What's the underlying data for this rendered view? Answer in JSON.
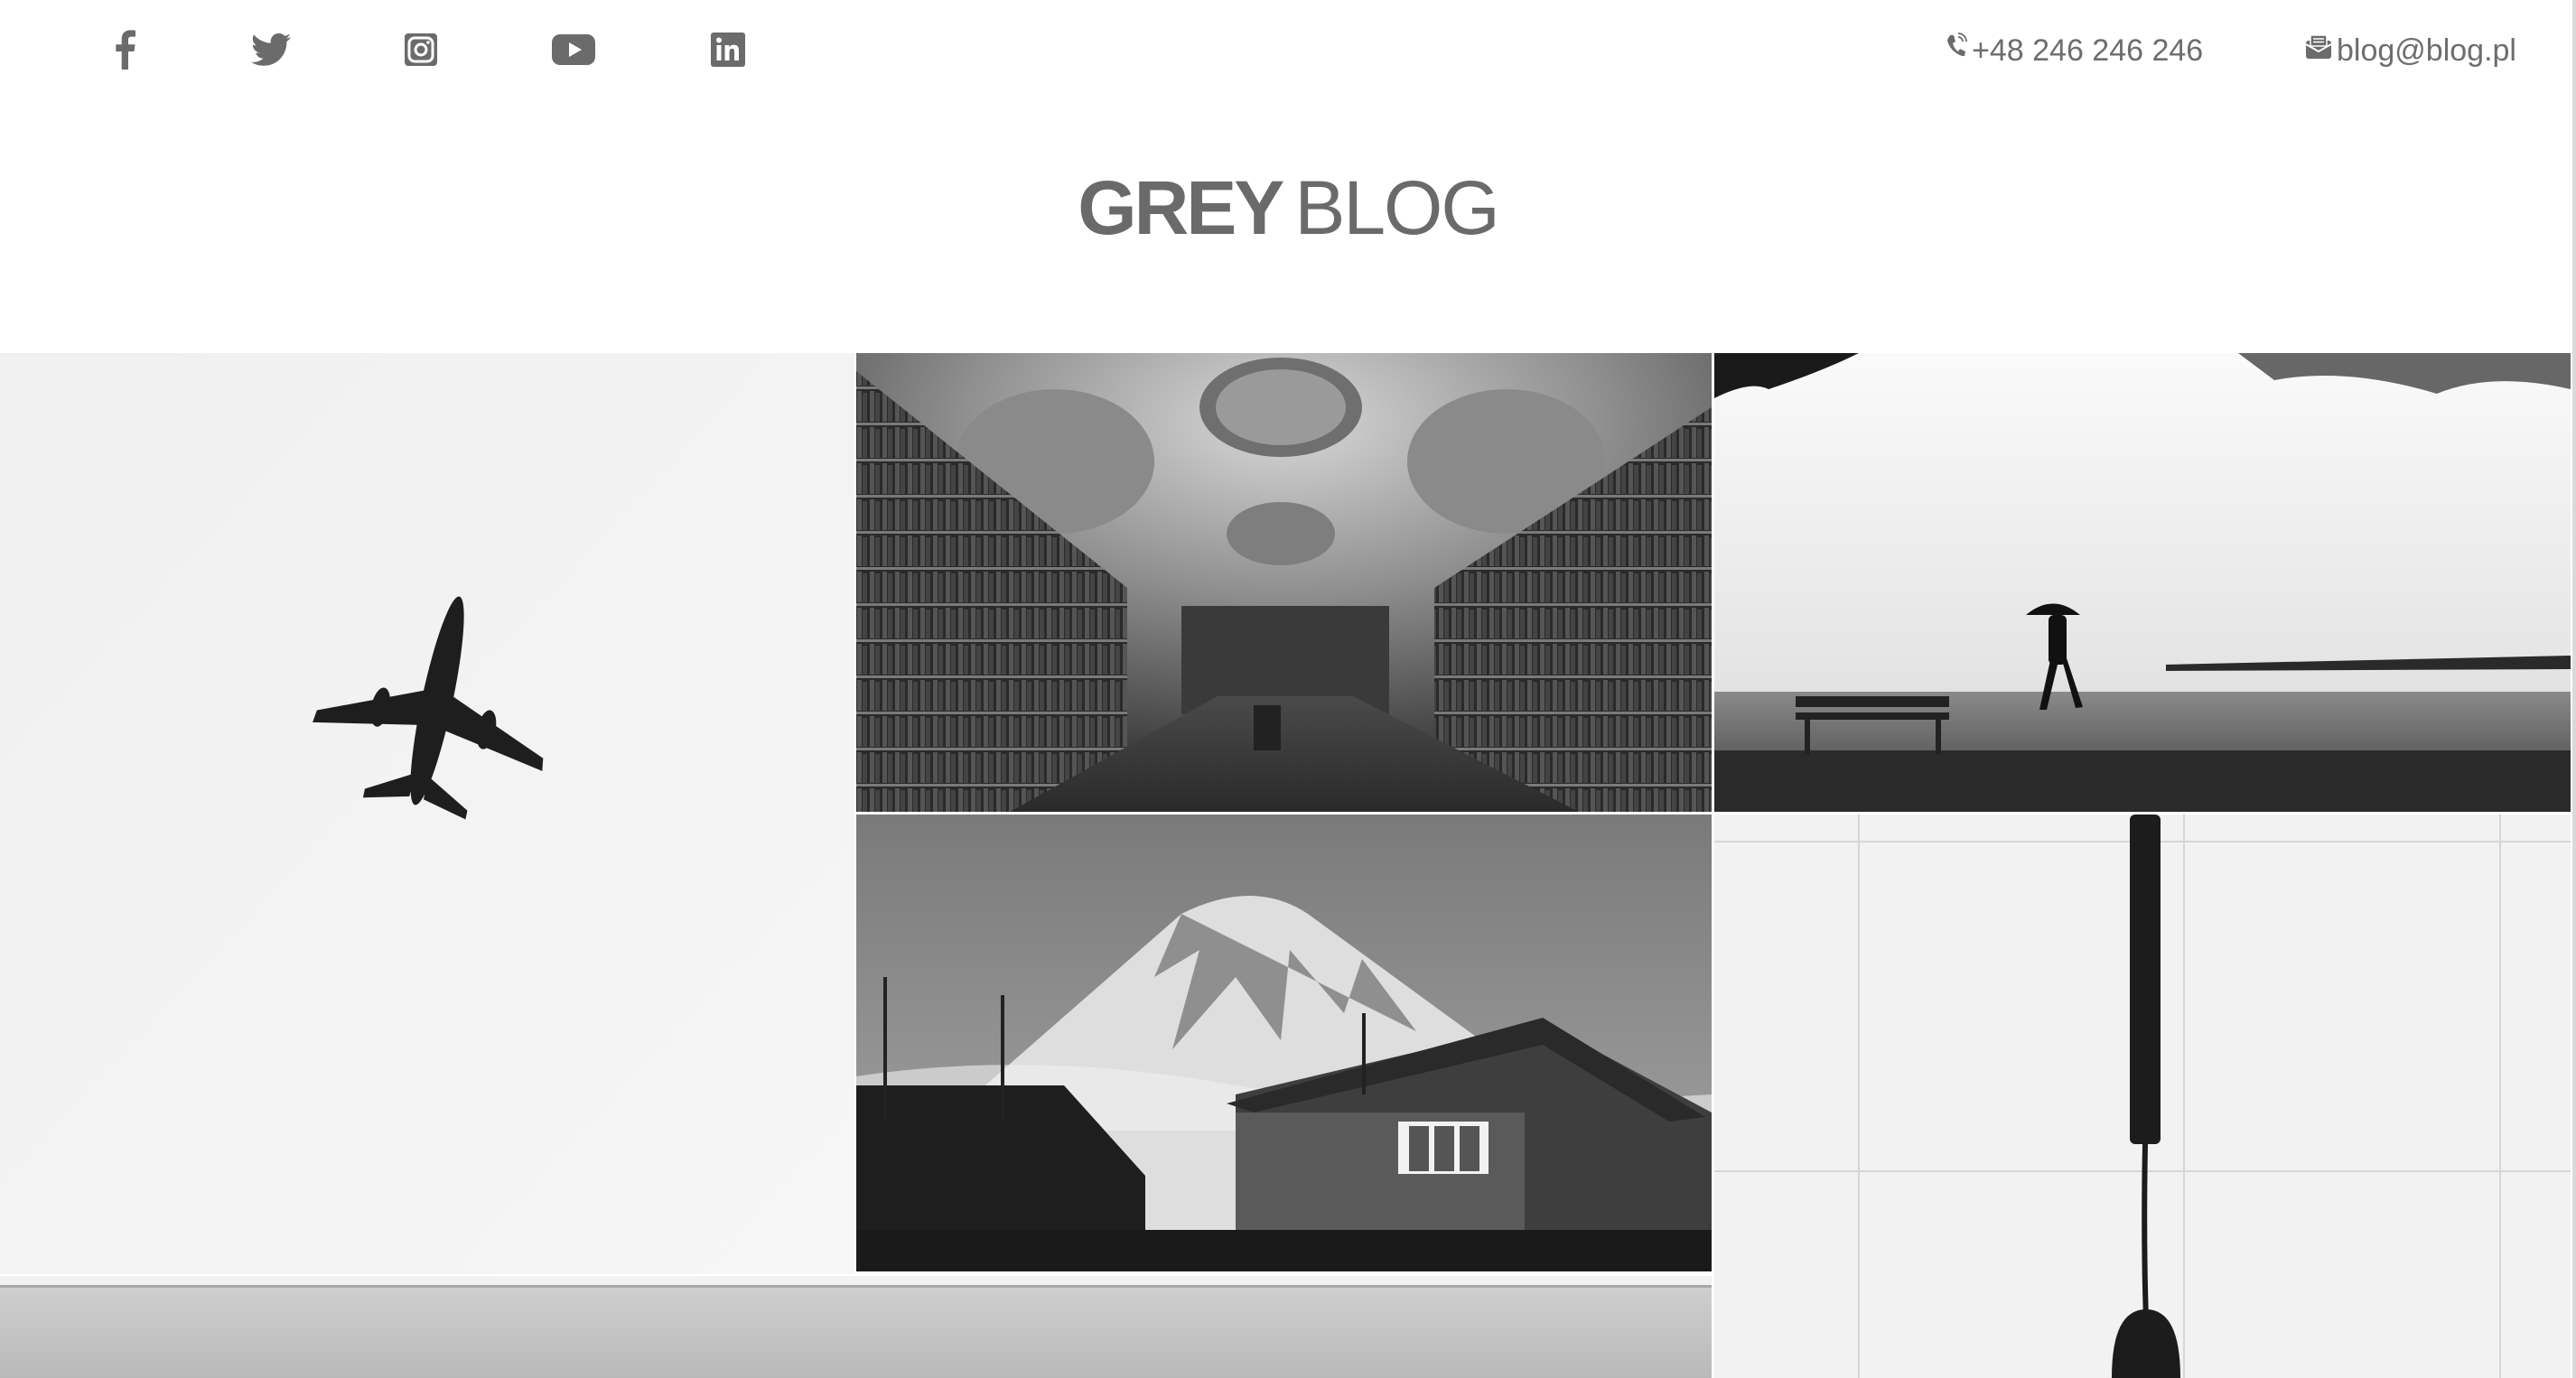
{
  "header": {
    "social_icons": [
      "facebook-icon",
      "twitter-icon",
      "instagram-icon",
      "youtube-icon",
      "linkedin-icon"
    ],
    "phone": "+48 246 246 246",
    "email": "blog@blog.pl"
  },
  "site": {
    "title_bold": "GREY",
    "title_light": "BLOG"
  },
  "colors": {
    "icon": "#6b6b6b",
    "text": "#6d6d6d",
    "background": "#ffffff"
  },
  "gallery": {
    "photos": [
      "airplane-in-sky",
      "baroque-library-hall",
      "person-with-umbrella-by-lake",
      "snowy-mountain-and-houses",
      "wall-lamp-on-tiles",
      "calm-sea-horizon"
    ]
  }
}
